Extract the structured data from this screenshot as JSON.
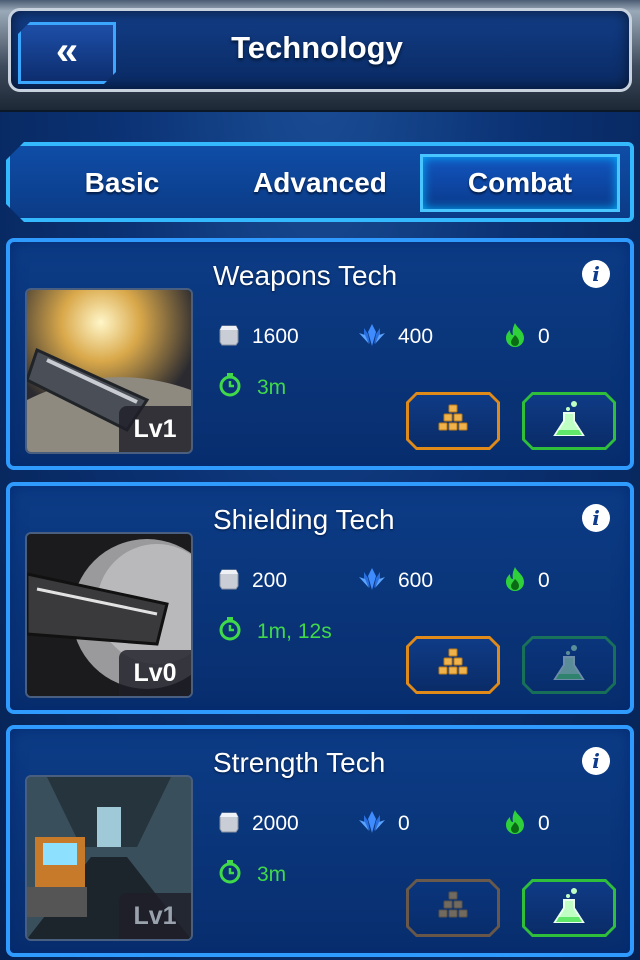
{
  "header": {
    "title": "Technology",
    "back_icon": "double-chevron-left-icon"
  },
  "tabs": [
    {
      "label": "Basic",
      "active": false
    },
    {
      "label": "Advanced",
      "active": false
    },
    {
      "label": "Combat",
      "active": true
    }
  ],
  "colors": {
    "accent": "#2f9bff",
    "time": "#3fd94a",
    "gold_button": "#e08a1a",
    "green_button": "#2fbf3a"
  },
  "techs": [
    {
      "title": "Weapons Tech",
      "level": "Lv1",
      "metal": "1600",
      "crystal": "400",
      "energy": "0",
      "time": "3m",
      "upgrade_enabled": true,
      "research_enabled": true
    },
    {
      "title": "Shielding Tech",
      "level": "Lv0",
      "metal": "200",
      "crystal": "600",
      "energy": "0",
      "time": "1m, 12s",
      "upgrade_enabled": true,
      "research_enabled": false
    },
    {
      "title": "Strength Tech",
      "level": "Lv1",
      "metal": "2000",
      "crystal": "0",
      "energy": "0",
      "time": "3m",
      "upgrade_enabled": false,
      "research_enabled": true
    }
  ]
}
